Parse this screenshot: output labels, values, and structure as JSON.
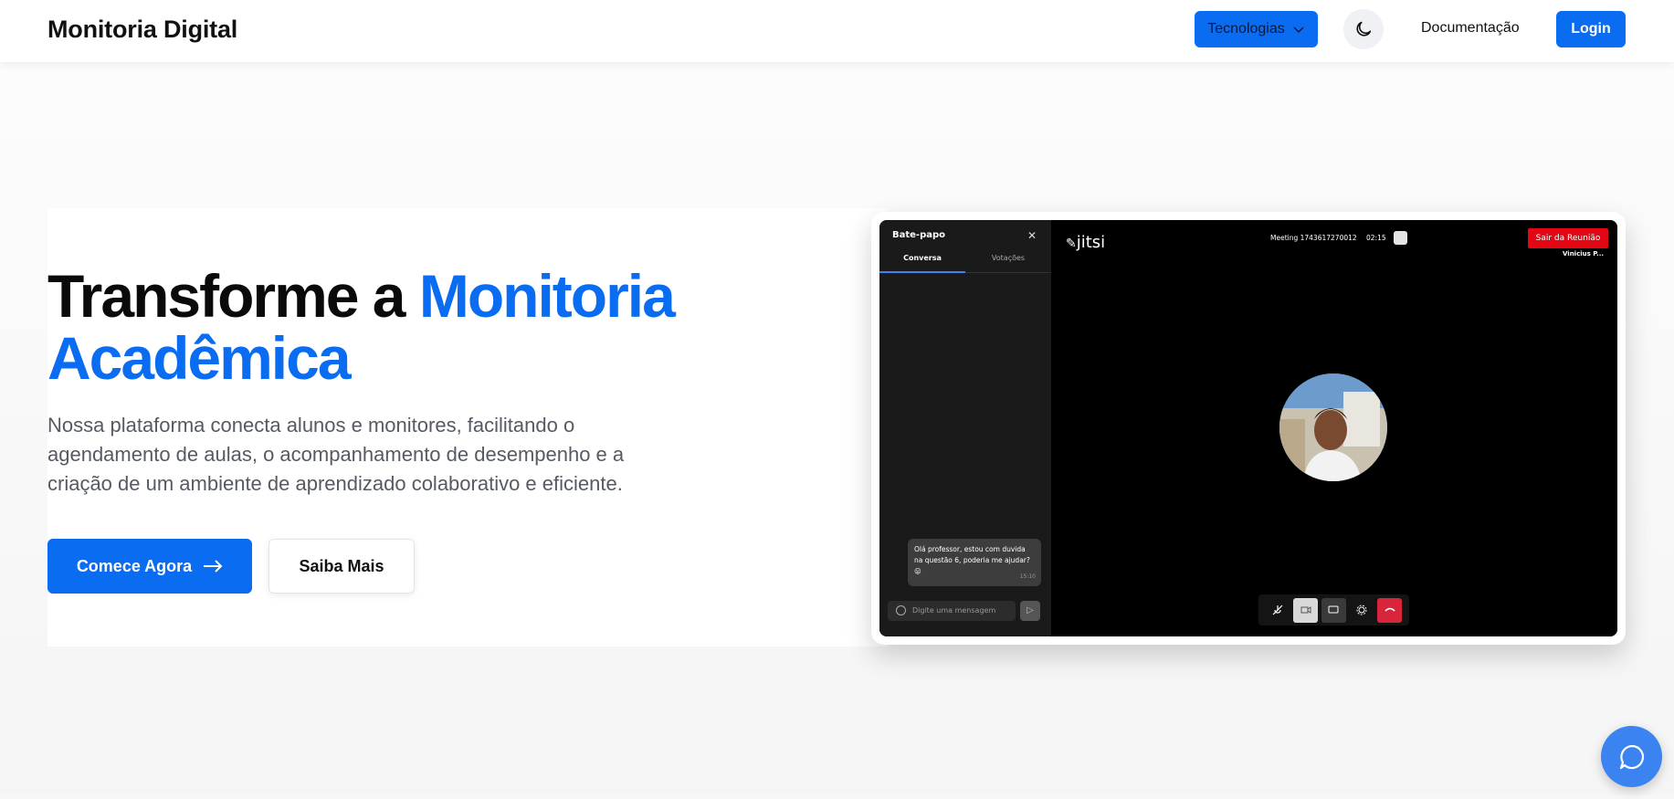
{
  "navbar": {
    "brand": "Monitoria Digital",
    "tech_label": "Tecnologias",
    "docs_label": "Documentação",
    "login_label": "Login"
  },
  "hero": {
    "title_part1": "Transforme a",
    "title_accent": "Monitoria Acadêmica",
    "description": "Nossa plataforma conecta alunos e monitores, facilitando o agendamento de aulas, o acompanhamento de desempenho e a criação de um ambiente de aprendizado colaborativo e eficiente.",
    "start_label": "Comece Agora",
    "more_label": "Saiba Mais"
  },
  "meeting": {
    "chat_title": "Bate-papo",
    "tab_conversa": "Conversa",
    "tab_votacoes": "Votações",
    "message": "Olá professor, estou com duvida na questão 6, poderia me ajudar? 😛",
    "message_time": "15:10",
    "input_placeholder": "Digite uma mensagem",
    "brand": "jitsi",
    "meeting_id": "Meeting 1743617270012",
    "timer": "02:15",
    "leave_label": "Sair da Reunião",
    "participant": "Vinicius P..."
  },
  "colors": {
    "accent": "#0a6cf0",
    "leave": "#e30613",
    "hangup": "#d9253b",
    "fab": "#3b83f0"
  }
}
